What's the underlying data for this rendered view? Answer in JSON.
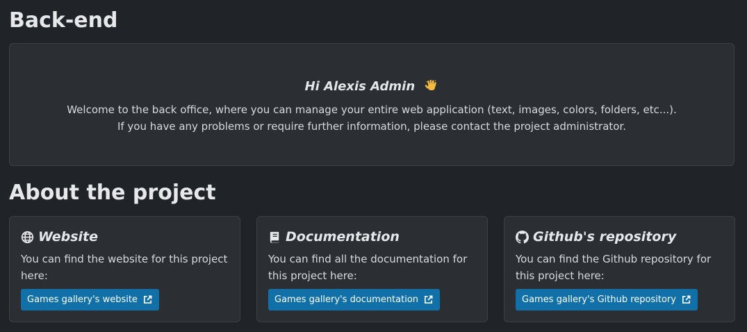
{
  "page_title": "Back-end",
  "welcome": {
    "greeting": "Hi Alexis Admin",
    "greeting_icon": "waving-hand-icon",
    "line1": "Welcome to the back office, where you can manage your entire web application (text, images, colors, folders, etc...).",
    "line2": "If you have any problems or require further information, please contact the project administrator."
  },
  "about_title": "About the project",
  "cards": [
    {
      "title": "Website",
      "icon": "globe-icon",
      "text": "You can find the website for this project here:",
      "button_label": "Games gallery's website",
      "button_icon": "external-link-icon"
    },
    {
      "title": "Documentation",
      "icon": "book-icon",
      "text": "You can find all the documentation for this project here:",
      "button_label": "Games gallery's documentation",
      "button_icon": "external-link-icon"
    },
    {
      "title": "Github's repository",
      "icon": "github-icon",
      "text": "You can find the Github repository for this project here:",
      "button_label": "Games gallery's Github repository",
      "button_icon": "external-link-icon"
    }
  ],
  "colors": {
    "background": "#202327",
    "card_background": "#2b2f33",
    "card_border": "#3b4047",
    "button": "#1170a8",
    "text": "#dfe2e5"
  }
}
